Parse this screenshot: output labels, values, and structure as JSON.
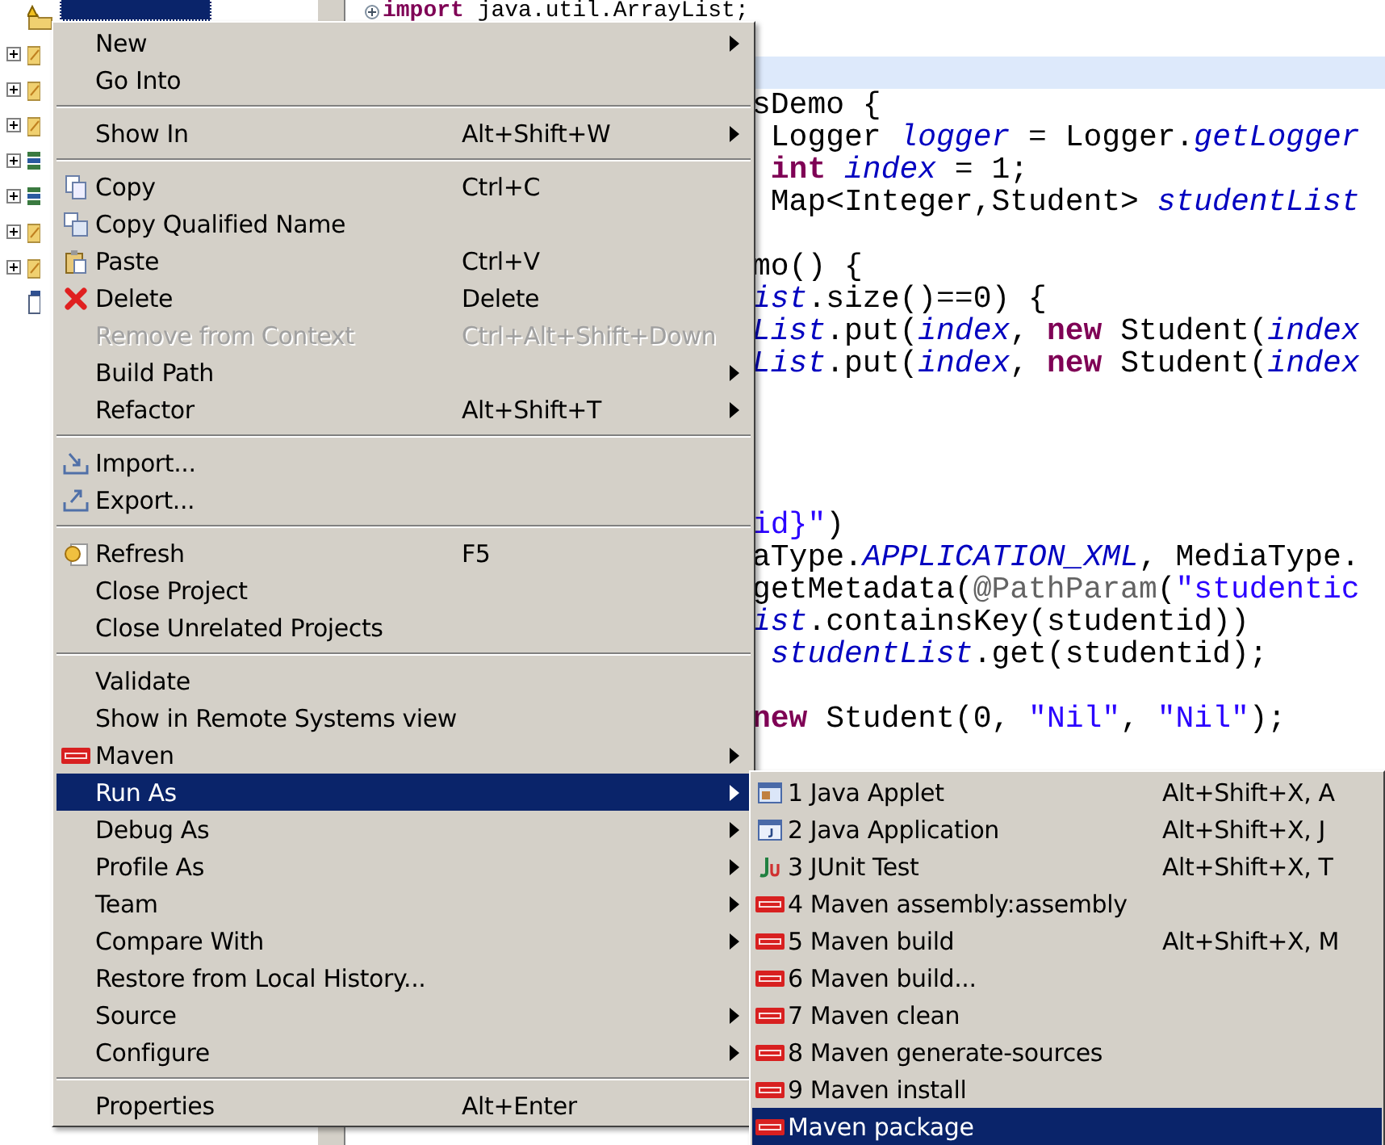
{
  "tree": {
    "items": [
      {
        "kind": "project",
        "expandable": false,
        "selected": true
      },
      {
        "kind": "folder",
        "expandable": true,
        "selected": false
      },
      {
        "kind": "folder",
        "expandable": true,
        "selected": false
      },
      {
        "kind": "folder",
        "expandable": true,
        "selected": false
      },
      {
        "kind": "library",
        "expandable": true,
        "selected": false
      },
      {
        "kind": "library",
        "expandable": true,
        "selected": false
      },
      {
        "kind": "folder",
        "expandable": true,
        "selected": false
      },
      {
        "kind": "folder",
        "expandable": true,
        "selected": false
      },
      {
        "kind": "file",
        "expandable": false,
        "selected": false
      }
    ]
  },
  "editor": {
    "lines": [
      {
        "kind": "folded",
        "segments": [
          {
            "kind": "keyword",
            "text": "import"
          },
          {
            "kind": "plain",
            "text": " java.util.ArrayList;"
          }
        ]
      },
      {
        "kind": "blank",
        "current": false
      },
      {
        "kind": "blank",
        "current": true
      },
      {
        "kind": "code",
        "segments": [
          {
            "kind": "plain",
            "text": "sDemo {"
          }
        ]
      },
      {
        "kind": "code",
        "segments": [
          {
            "kind": "plain",
            "text": " Logger "
          },
          {
            "kind": "field",
            "text": "logger"
          },
          {
            "kind": "plain",
            "text": " = Logger."
          },
          {
            "kind": "field",
            "text": "getLogger"
          }
        ]
      },
      {
        "kind": "code",
        "segments": [
          {
            "kind": "keyword",
            "text": " int "
          },
          {
            "kind": "field",
            "text": "index"
          },
          {
            "kind": "plain",
            "text": " = 1;"
          }
        ]
      },
      {
        "kind": "code",
        "segments": [
          {
            "kind": "plain",
            "text": " Map<Integer,Student> "
          },
          {
            "kind": "field",
            "text": "studentList"
          }
        ]
      },
      {
        "kind": "blank",
        "current": false
      },
      {
        "kind": "code",
        "segments": [
          {
            "kind": "plain",
            "text": "mo() {"
          }
        ]
      },
      {
        "kind": "code",
        "segments": [
          {
            "kind": "field",
            "text": "ist"
          },
          {
            "kind": "plain",
            "text": ".size()==0) {"
          }
        ]
      },
      {
        "kind": "code",
        "segments": [
          {
            "kind": "field",
            "text": "List"
          },
          {
            "kind": "plain",
            "text": ".put("
          },
          {
            "kind": "field",
            "text": "index"
          },
          {
            "kind": "plain",
            "text": ", "
          },
          {
            "kind": "keyword",
            "text": "new"
          },
          {
            "kind": "plain",
            "text": " Student("
          },
          {
            "kind": "field",
            "text": "index"
          }
        ]
      },
      {
        "kind": "code",
        "segments": [
          {
            "kind": "field",
            "text": "List"
          },
          {
            "kind": "plain",
            "text": ".put("
          },
          {
            "kind": "field",
            "text": "index"
          },
          {
            "kind": "plain",
            "text": ", "
          },
          {
            "kind": "keyword",
            "text": "new"
          },
          {
            "kind": "plain",
            "text": " Student("
          },
          {
            "kind": "field",
            "text": "index"
          }
        ]
      },
      {
        "kind": "blank",
        "current": false
      },
      {
        "kind": "blank",
        "current": false
      },
      {
        "kind": "blank",
        "current": false
      },
      {
        "kind": "blank",
        "current": false
      },
      {
        "kind": "code",
        "segments": [
          {
            "kind": "string",
            "text": "id}\""
          },
          {
            "kind": "plain",
            "text": ")"
          }
        ]
      },
      {
        "kind": "code",
        "segments": [
          {
            "kind": "plain",
            "text": "aType."
          },
          {
            "kind": "field",
            "text": "APPLICATION_XML"
          },
          {
            "kind": "plain",
            "text": ", MediaType."
          }
        ]
      },
      {
        "kind": "code",
        "segments": [
          {
            "kind": "plain",
            "text": "getMetadata("
          },
          {
            "kind": "annotation",
            "text": "@PathParam"
          },
          {
            "kind": "plain",
            "text": "("
          },
          {
            "kind": "string",
            "text": "\"studentic"
          }
        ]
      },
      {
        "kind": "code",
        "segments": [
          {
            "kind": "field",
            "text": "ist"
          },
          {
            "kind": "plain",
            "text": ".containsKey(studentid))"
          }
        ]
      },
      {
        "kind": "code",
        "segments": [
          {
            "kind": "field",
            "text": " studentList"
          },
          {
            "kind": "plain",
            "text": ".get(studentid);"
          }
        ]
      },
      {
        "kind": "blank",
        "current": false
      },
      {
        "kind": "code",
        "segments": [
          {
            "kind": "keyword",
            "text": "new"
          },
          {
            "kind": "plain",
            "text": " Student(0, "
          },
          {
            "kind": "string",
            "text": "\"Nil\""
          },
          {
            "kind": "plain",
            "text": ", "
          },
          {
            "kind": "string",
            "text": "\"Nil\""
          },
          {
            "kind": "plain",
            "text": ");"
          }
        ]
      }
    ]
  },
  "context_menu": {
    "items": [
      {
        "kind": "item",
        "label": "New",
        "submenu": true,
        "disabled": false,
        "selected": false
      },
      {
        "kind": "item",
        "label": "Go Into",
        "submenu": false,
        "disabled": false,
        "selected": false
      },
      {
        "kind": "separator"
      },
      {
        "kind": "item",
        "label": "Show In",
        "shortcut": "Alt+Shift+W",
        "submenu": true,
        "disabled": false,
        "selected": false
      },
      {
        "kind": "separator"
      },
      {
        "kind": "copy",
        "label": "Copy",
        "shortcut": "Ctrl+C",
        "submenu": false,
        "disabled": false,
        "selected": false
      },
      {
        "kind": "copy-qualified",
        "label": "Copy Qualified Name",
        "submenu": false,
        "disabled": false,
        "selected": false
      },
      {
        "kind": "paste",
        "label": "Paste",
        "shortcut": "Ctrl+V",
        "submenu": false,
        "disabled": false,
        "selected": false
      },
      {
        "kind": "delete",
        "label": "Delete",
        "shortcut": "Delete",
        "submenu": false,
        "disabled": false,
        "selected": false
      },
      {
        "kind": "item",
        "label": "Remove from Context",
        "shortcut": "Ctrl+Alt+Shift+Down",
        "submenu": false,
        "disabled": true,
        "selected": false
      },
      {
        "kind": "item",
        "label": "Build Path",
        "submenu": true,
        "disabled": false,
        "selected": false
      },
      {
        "kind": "item",
        "label": "Refactor",
        "shortcut": "Alt+Shift+T",
        "submenu": true,
        "disabled": false,
        "selected": false
      },
      {
        "kind": "separator"
      },
      {
        "kind": "import",
        "label": "Import...",
        "submenu": false,
        "disabled": false,
        "selected": false
      },
      {
        "kind": "export",
        "label": "Export...",
        "submenu": false,
        "disabled": false,
        "selected": false
      },
      {
        "kind": "separator"
      },
      {
        "kind": "refresh",
        "label": "Refresh",
        "shortcut": "F5",
        "submenu": false,
        "disabled": false,
        "selected": false
      },
      {
        "kind": "item",
        "label": "Close Project",
        "submenu": false,
        "disabled": false,
        "selected": false
      },
      {
        "kind": "item",
        "label": "Close Unrelated Projects",
        "submenu": false,
        "disabled": false,
        "selected": false
      },
      {
        "kind": "separator"
      },
      {
        "kind": "item",
        "label": "Validate",
        "submenu": false,
        "disabled": false,
        "selected": false
      },
      {
        "kind": "item",
        "label": "Show in Remote Systems view",
        "submenu": false,
        "disabled": false,
        "selected": false
      },
      {
        "kind": "maven",
        "label": "Maven",
        "submenu": true,
        "disabled": false,
        "selected": false
      },
      {
        "kind": "item",
        "label": "Run As",
        "submenu": true,
        "disabled": false,
        "selected": true
      },
      {
        "kind": "item",
        "label": "Debug As",
        "submenu": true,
        "disabled": false,
        "selected": false
      },
      {
        "kind": "item",
        "label": "Profile As",
        "submenu": true,
        "disabled": false,
        "selected": false
      },
      {
        "kind": "item",
        "label": "Team",
        "submenu": true,
        "disabled": false,
        "selected": false
      },
      {
        "kind": "item",
        "label": "Compare With",
        "submenu": true,
        "disabled": false,
        "selected": false
      },
      {
        "kind": "item",
        "label": "Restore from Local History...",
        "submenu": false,
        "disabled": false,
        "selected": false
      },
      {
        "kind": "item",
        "label": "Source",
        "submenu": true,
        "disabled": false,
        "selected": false
      },
      {
        "kind": "item",
        "label": "Configure",
        "submenu": true,
        "disabled": false,
        "selected": false
      },
      {
        "kind": "separator"
      },
      {
        "kind": "item",
        "label": "Properties",
        "shortcut": "Alt+Enter",
        "submenu": false,
        "disabled": false,
        "selected": false
      }
    ]
  },
  "run_as_submenu": {
    "items": [
      {
        "kind": "applet",
        "label": "1 Java Applet",
        "shortcut": "Alt+Shift+X, A",
        "selected": false
      },
      {
        "kind": "application",
        "label": "2 Java Application",
        "shortcut": "Alt+Shift+X, J",
        "selected": false
      },
      {
        "kind": "junit",
        "label": "3 JUnit Test",
        "shortcut": "Alt+Shift+X, T",
        "selected": false
      },
      {
        "kind": "maven",
        "label": "4 Maven assembly:assembly",
        "selected": false
      },
      {
        "kind": "maven",
        "label": "5 Maven build",
        "shortcut": "Alt+Shift+X, M",
        "selected": false
      },
      {
        "kind": "maven",
        "label": "6 Maven build...",
        "selected": false
      },
      {
        "kind": "maven",
        "label": "7 Maven clean",
        "selected": false
      },
      {
        "kind": "maven",
        "label": "8 Maven generate-sources",
        "selected": false
      },
      {
        "kind": "maven",
        "label": "9 Maven install",
        "selected": false
      },
      {
        "kind": "maven",
        "label": "Maven package",
        "selected": true
      }
    ]
  }
}
